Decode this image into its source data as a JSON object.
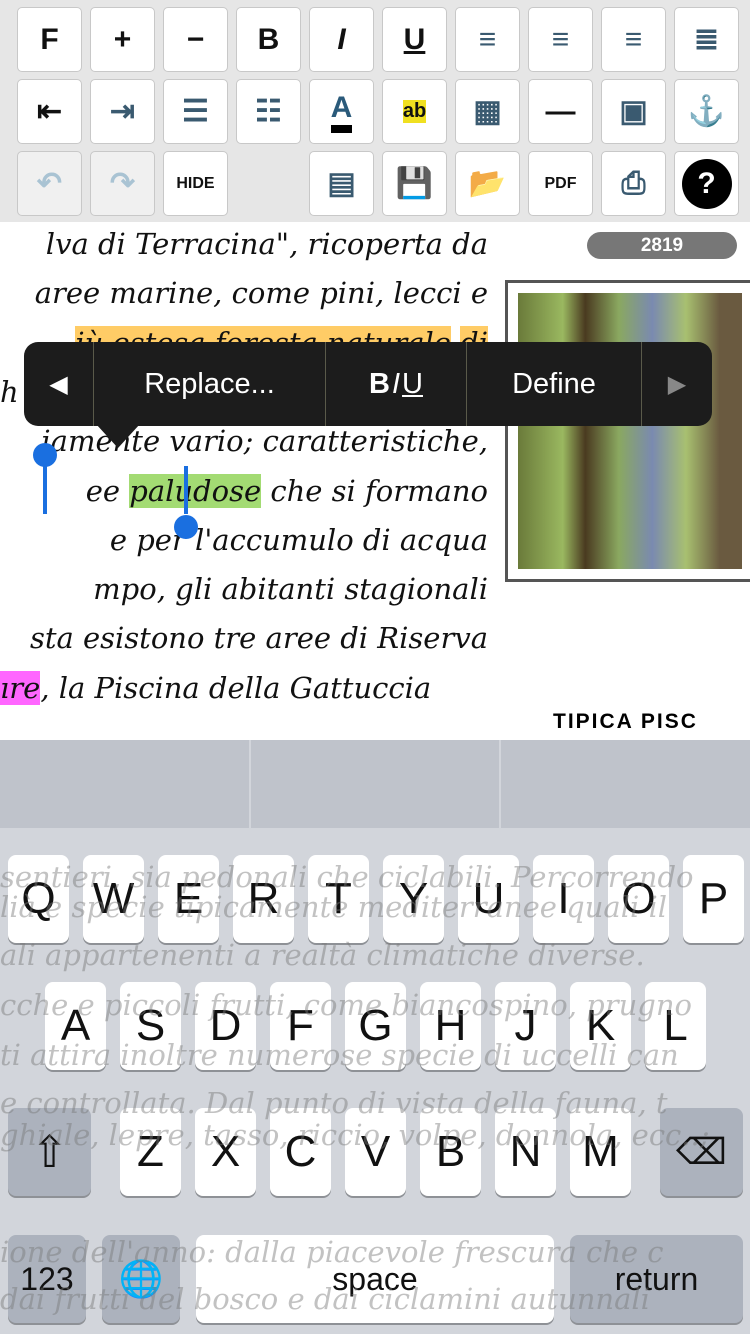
{
  "toolbar": {
    "row1": [
      {
        "name": "font-icon",
        "glyph": "F"
      },
      {
        "name": "increase-size-icon",
        "glyph": "+"
      },
      {
        "name": "decrease-size-icon",
        "glyph": "−"
      },
      {
        "name": "bold-icon",
        "glyph": "B"
      },
      {
        "name": "italic-icon",
        "glyph": "I"
      },
      {
        "name": "underline-icon",
        "glyph": "U"
      },
      {
        "name": "align-left-icon",
        "glyph": "≡"
      },
      {
        "name": "align-center-icon",
        "glyph": "≡"
      },
      {
        "name": "align-right-icon",
        "glyph": "≡"
      },
      {
        "name": "justify-icon",
        "glyph": "≣"
      }
    ],
    "row2": [
      {
        "name": "outdent-icon",
        "glyph": "⇤"
      },
      {
        "name": "indent-icon",
        "glyph": "⇥"
      },
      {
        "name": "numbered-list-icon",
        "glyph": "☰"
      },
      {
        "name": "bullet-list-icon",
        "glyph": "☷"
      },
      {
        "name": "text-color-icon",
        "glyph": "A"
      },
      {
        "name": "highlight-icon",
        "glyph": "ab"
      },
      {
        "name": "table-icon",
        "glyph": "▦"
      },
      {
        "name": "horizontal-rule-icon",
        "glyph": "—"
      },
      {
        "name": "image-icon",
        "glyph": "▣"
      },
      {
        "name": "anchor-icon",
        "glyph": "⚓"
      }
    ],
    "row3": [
      {
        "name": "undo-icon",
        "glyph": "↶",
        "disabled": true
      },
      {
        "name": "redo-icon",
        "glyph": "↷",
        "disabled": true
      },
      {
        "name": "hide-icon",
        "glyph": "HIDE"
      },
      null,
      {
        "name": "document-icon",
        "glyph": "▤"
      },
      {
        "name": "save-icon",
        "glyph": "💾"
      },
      {
        "name": "export-icon",
        "glyph": "📂"
      },
      {
        "name": "pdf-icon",
        "glyph": "PDF"
      },
      {
        "name": "print-icon",
        "glyph": "⎙"
      },
      {
        "name": "help-icon",
        "glyph": "?"
      }
    ]
  },
  "document": {
    "counter": "2819",
    "caption": "TIPICA PISC",
    "lines": [
      [
        {
          "t": "lva di Terracina\", ricoperta da"
        }
      ],
      [
        {
          "t": "aree marine, come pini, lecci e"
        }
      ],
      [
        {
          "t": "iù estesa foresta naturale",
          "h": "o"
        },
        {
          "t": " "
        },
        {
          "t": "di",
          "h": "o"
        }
      ],
      [
        {
          "t": "h"
        }
      ],
      [
        {
          "t": "iamente vario; caratteristiche,"
        }
      ],
      [
        {
          "t": "ee "
        },
        {
          "t": "paludose",
          "h": "g"
        },
        {
          "t": " che si formano"
        }
      ],
      [
        {
          "t": "e per l'accumulo di acqua"
        }
      ],
      [
        {
          "t": "mpo, gli abitanti stagionali"
        }
      ],
      [
        {
          "t": "sta esistono tre aree di Riserva"
        }
      ],
      [
        {
          "t": "ıre",
          "h": "p"
        },
        {
          "t": ", la Piscina della Gattuccia"
        }
      ]
    ]
  },
  "context_menu": {
    "prev": "◀",
    "replace": "Replace...",
    "biu_b": "B",
    "biu_i": "I",
    "biu_u": "U",
    "define": "Define",
    "next": "▶"
  },
  "keyboard": {
    "row1": [
      "Q",
      "W",
      "E",
      "R",
      "T",
      "Y",
      "U",
      "I",
      "O",
      "P"
    ],
    "row2": [
      "A",
      "S",
      "D",
      "F",
      "G",
      "H",
      "J",
      "K",
      "L"
    ],
    "row3": [
      "Z",
      "X",
      "C",
      "V",
      "B",
      "N",
      "M"
    ],
    "shift": "⇧",
    "delete": "⌫",
    "numbers": "123",
    "globe": "🌐",
    "space": "space",
    "return": "return"
  },
  "ghost_text": [
    "sentieri, sia pedonali che ciclabili. Percorrendo",
    "lià e specie tipicamente mediterranee quali il",
    "ali appartenenti a realtà  climatiche diverse.",
    "cche e piccoli frutti, come biancospino, prugno",
    "ti attira inoltre numerose specie di uccelli can",
    "e controllata. Dal punto di vista della fauna, t",
    "ghiale, lepre, tasso, riccio, volpe, donnola, ecc..;",
    "ione dell'anno: dalla piacevole frescura che c",
    "dai frutti del bosco e dai ciclamini autunnali"
  ]
}
